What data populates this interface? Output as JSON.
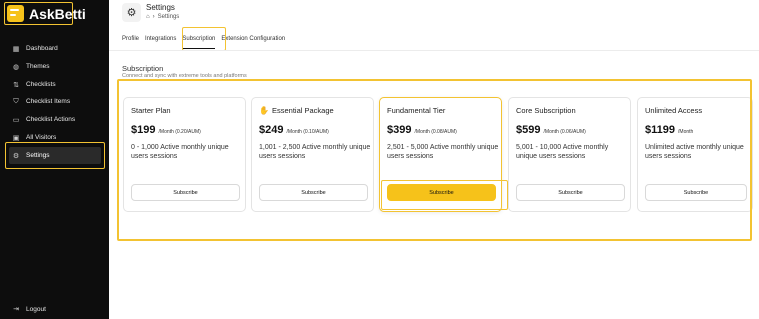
{
  "app": {
    "name": "AskBetti"
  },
  "sidebar": {
    "items": [
      {
        "label": "Dashboard",
        "icon": "grid-icon"
      },
      {
        "label": "Themes",
        "icon": "palette-icon"
      },
      {
        "label": "Checklists",
        "icon": "flow-icon"
      },
      {
        "label": "Checklist Items",
        "icon": "shield-check-icon"
      },
      {
        "label": "Checklist Actions",
        "icon": "inbox-icon"
      },
      {
        "label": "All Visitors",
        "icon": "user-badge-icon"
      },
      {
        "label": "Settings",
        "icon": "gear-icon",
        "active": true
      }
    ],
    "logout_label": "Logout"
  },
  "header": {
    "title": "Settings",
    "breadcrumb": [
      "home",
      "Settings"
    ]
  },
  "tabs": [
    {
      "label": "Profile"
    },
    {
      "label": "Integrations"
    },
    {
      "label": "Subscription",
      "active": true
    },
    {
      "label": "Extension Configuration"
    }
  ],
  "section": {
    "title": "Subscription",
    "subtitle": "Connect and sync with extreme tools and platforms"
  },
  "plans": [
    {
      "name": "Starter Plan",
      "price": "$199",
      "unit": "/Month (0.20/AUM)",
      "description": "0 - 1,000 Active monthly unique users sessions",
      "button": "Subscribe"
    },
    {
      "name": "Essential Package",
      "price": "$249",
      "unit": "/Month (0.10/AUM)",
      "description": "1,001 - 2,500 Active monthly unique users sessions",
      "button": "Subscribe"
    },
    {
      "name": "Fundamental Tier",
      "price": "$399",
      "unit": "/Month (0.08/AUM)",
      "description": "2,501 - 5,000 Active monthly unique users sessions",
      "button": "Subscribe",
      "featured": true
    },
    {
      "name": "Core Subscription",
      "price": "$599",
      "unit": "/Month (0.06/AUM)",
      "description": "5,001 - 10,000 Active monthly unique users sessions",
      "button": "Subscribe"
    },
    {
      "name": "Unlimited Access",
      "price": "$1199",
      "unit": "/Month",
      "description": "Unlimited active monthly unique users sessions",
      "button": "Subscribe"
    }
  ],
  "colors": {
    "accent": "#f6c21a",
    "highlight": "#f3c332",
    "sidebar_bg": "#0d0d0d"
  }
}
